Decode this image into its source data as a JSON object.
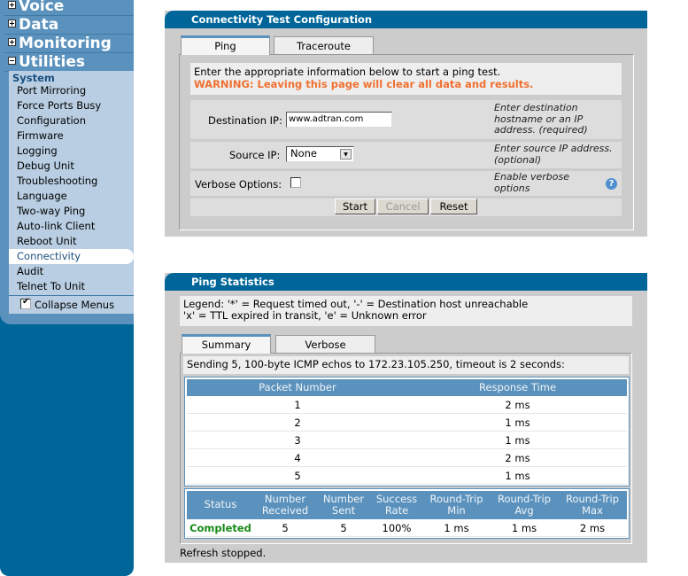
{
  "sidebar": {
    "categories": [
      {
        "label": "Voice",
        "expanded": false
      },
      {
        "label": "Data",
        "expanded": false
      },
      {
        "label": "Monitoring",
        "expanded": false
      },
      {
        "label": "Utilities",
        "expanded": true
      }
    ],
    "section_heading": "System",
    "items": [
      {
        "label": "Port Mirroring"
      },
      {
        "label": "Force Ports Busy"
      },
      {
        "label": "Configuration"
      },
      {
        "label": "Firmware"
      },
      {
        "label": "Logging"
      },
      {
        "label": "Debug Unit"
      },
      {
        "label": "Troubleshooting"
      },
      {
        "label": "Language"
      },
      {
        "label": "Two-way Ping"
      },
      {
        "label": "Auto-link Client"
      },
      {
        "label": "Reboot Unit"
      },
      {
        "label": "Connectivity",
        "active": true
      },
      {
        "label": "Audit"
      },
      {
        "label": "Telnet To Unit"
      }
    ],
    "collapse_menus": {
      "label": "Collapse Menus",
      "checked": true
    }
  },
  "config_panel": {
    "title": "Connectivity Test Configuration",
    "tabs": [
      {
        "label": "Ping",
        "active": true
      },
      {
        "label": "Traceroute",
        "active": false
      }
    ],
    "intro": "Enter the appropriate information below to start a ping test.",
    "warning": "WARNING: Leaving this page will clear all data and results.",
    "fields": {
      "destination": {
        "label": "Destination IP:",
        "value": "www.adtran.com",
        "help": [
          "Enter destination",
          "hostname or an IP",
          "address. (required)"
        ]
      },
      "source": {
        "label": "Source IP:",
        "value": "None",
        "help": [
          "Enter source IP address.",
          "(optional)"
        ]
      },
      "verbose": {
        "label": "Verbose Options:",
        "checked": false,
        "help": [
          "Enable verbose",
          "options"
        ]
      }
    },
    "buttons": {
      "start": "Start",
      "cancel": "Cancel",
      "reset": "Reset"
    }
  },
  "stats_panel": {
    "title": "Ping Statistics",
    "legend": [
      "Legend: '*' = Request timed out, '-' = Destination host unreachable",
      "'x' = TTL expired in transit, 'e' = Unknown error"
    ],
    "tabs": [
      {
        "label": "Summary",
        "active": true
      },
      {
        "label": "Verbose",
        "active": false
      }
    ],
    "sending_text": "Sending 5, 100-byte ICMP echos to 172.23.105.250, timeout is 2 seconds:",
    "packets": {
      "headers": [
        "Packet Number",
        "Response Time"
      ],
      "rows": [
        [
          "1",
          "2 ms"
        ],
        [
          "2",
          "1 ms"
        ],
        [
          "3",
          "1 ms"
        ],
        [
          "4",
          "2 ms"
        ],
        [
          "5",
          "1 ms"
        ]
      ]
    },
    "summary": {
      "headers": [
        [
          "Status",
          ""
        ],
        [
          "Number",
          "Received"
        ],
        [
          "Number",
          "Sent"
        ],
        [
          "Success",
          "Rate"
        ],
        [
          "Round-Trip",
          "Min"
        ],
        [
          "Round-Trip",
          "Avg"
        ],
        [
          "Round-Trip",
          "Max"
        ]
      ],
      "row": [
        "Completed",
        "5",
        "5",
        "100%",
        "1 ms",
        "1 ms",
        "2 ms"
      ]
    },
    "footer": "Refresh stopped."
  }
}
